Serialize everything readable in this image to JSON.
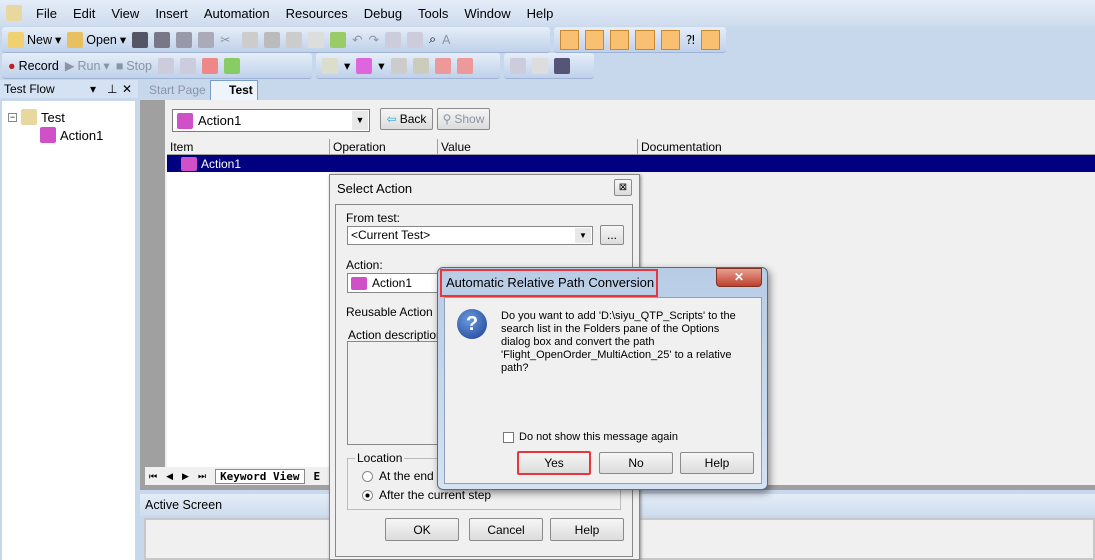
{
  "menu": [
    "File",
    "Edit",
    "View",
    "Insert",
    "Automation",
    "Resources",
    "Debug",
    "Tools",
    "Window",
    "Help"
  ],
  "toolbar": {
    "new": "New",
    "open": "Open",
    "record": "Record",
    "run": "Run",
    "stop": "Stop"
  },
  "test_flow": {
    "title": "Test Flow",
    "tree": {
      "root": "Test",
      "child": "Action1"
    }
  },
  "doc_tabs": [
    "Start Page",
    "Test"
  ],
  "keyword_view": {
    "action_combo": "Action1",
    "back": "Back",
    "show": "Show",
    "columns": [
      "Item",
      "Operation",
      "Value",
      "Documentation"
    ],
    "rows": [
      {
        "item": "Action1",
        "operation": "",
        "value": "",
        "documentation": ""
      }
    ],
    "bottom_tabs": [
      "Keyword View",
      "E"
    ]
  },
  "active_screen": {
    "title": "Active Screen"
  },
  "select_action": {
    "title": "Select Action",
    "from_test_label": "From test:",
    "from_test_value": "<Current Test>",
    "browse": "...",
    "action_label": "Action:",
    "action_value": "Action1",
    "reusable": "Reusable Action",
    "description_label": "Action description:",
    "location_label": "Location",
    "radio_end": "At the end of",
    "radio_after": "After the current step",
    "ok": "OK",
    "cancel": "Cancel",
    "help": "Help"
  },
  "message_box": {
    "title": "Automatic Relative Path Conversion",
    "message": "Do you want to add 'D:\\siyu_QTP_Scripts' to the search list in the Folders pane of the Options dialog box and convert the path 'Flight_OpenOrder_MultiAction_25' to a relative path?",
    "checkbox": "Do not show this message again",
    "yes": "Yes",
    "no": "No",
    "help": "Help",
    "highlight_color": "#e8363a"
  }
}
